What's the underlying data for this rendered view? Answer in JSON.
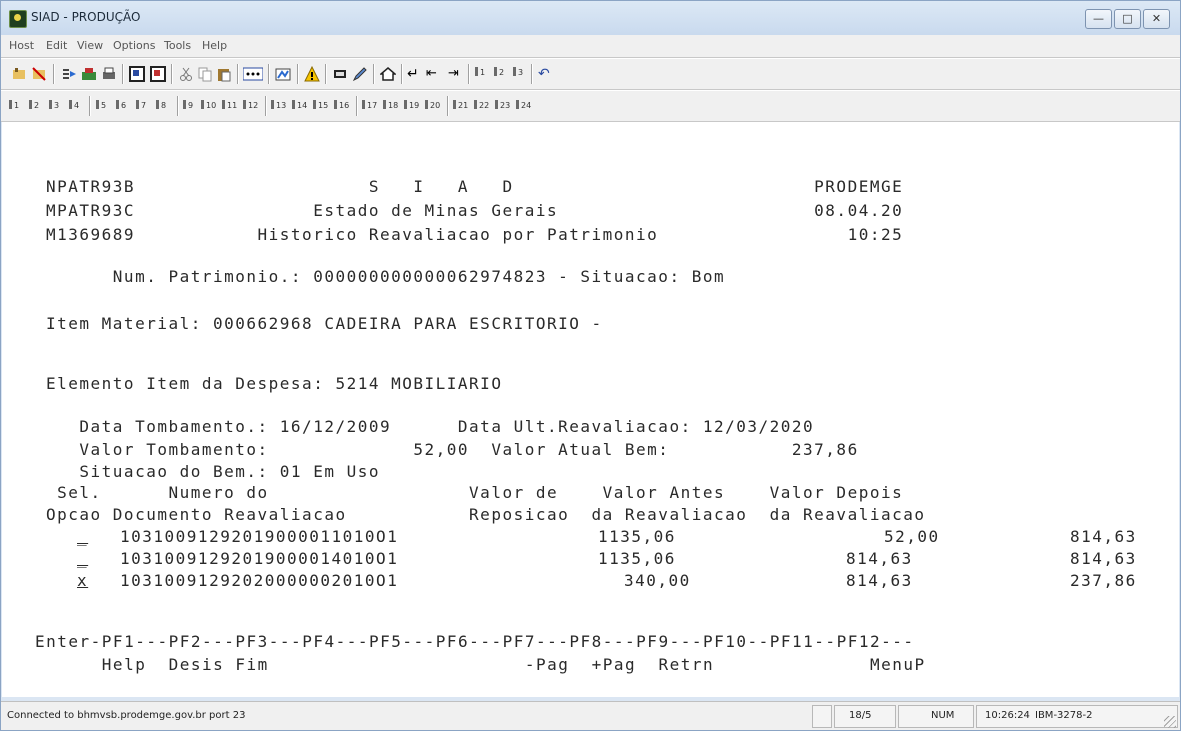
{
  "window": {
    "title": "SIAD - PRODUÇÃO",
    "buttons": [
      "minimize",
      "maximize",
      "close"
    ]
  },
  "menu": {
    "items": [
      "Host",
      "Edit",
      "View",
      "Options",
      "Tools",
      "Help"
    ]
  },
  "toolbar": {
    "icons": [
      "connect-icon",
      "disconnect-icon",
      "send-icon",
      "receive-icon",
      "print-icon",
      "screen-icon",
      "screen2-icon",
      "cut-icon",
      "copy-icon",
      "paste-icon",
      "dots-icon",
      "macro-icon",
      "warning-icon",
      "display-icon",
      "pencil-icon",
      "home-icon",
      "enter-icon",
      "backtab-icon",
      "tab-icon",
      "pf1-mini-icon",
      "pf2-mini-icon",
      "pf3-mini-icon",
      "undo-icon"
    ],
    "pf_keys": [
      "1",
      "2",
      "3",
      "4",
      "5",
      "6",
      "7",
      "8",
      "9",
      "10",
      "11",
      "12",
      "13",
      "14",
      "15",
      "16",
      "17",
      "18",
      "19",
      "20",
      "21",
      "22",
      "23",
      "24"
    ]
  },
  "terminal": {
    "lines": {
      "l1": "NPATR93B                     S   I   A   D                           PRODEMGE",
      "l2": "MPATR93C                Estado de Minas Gerais                       08.04.20",
      "l3": "M1369689           Historico Reavaliacao por Patrimonio                 10:25",
      "l4": "      Num. Patrimonio.: 000000000000062974823 - Situacao: Bom",
      "l5": "Item Material: 000662968 CADEIRA PARA ESCRITORIO -",
      "l6": "Elemento Item da Despesa: 5214 MOBILIARIO",
      "l7": "   Data Tombamento.: 16/12/2009      Data Ult.Reavaliacao: 12/03/2020",
      "l8": "   Valor Tombamento:             52,00  Valor Atual Bem:           237,86",
      "l9": "   Situacao do Bem.: 01 Em Uso",
      "l10": " Sel.      Numero do                  Valor de    Valor Antes    Valor Depois",
      "l11": "Opcao Documento Reavaliacao           Reposicao  da Reavaliacao  da Reavaliacao"
    },
    "rows": [
      {
        "sel": "_",
        "doc": "10310091292019000011010O1",
        "reposicao": "1135,06",
        "antes": "52,00",
        "depois": "814,63"
      },
      {
        "sel": "_",
        "doc": "10310091292019000014010O1",
        "reposicao": "1135,06",
        "antes": "814,63",
        "depois": "814,63"
      },
      {
        "sel": "x",
        "doc": "10310091292020000002010O1",
        "reposicao": "340,00",
        "antes": "814,63",
        "depois": "237,86"
      }
    ],
    "pf_line": "Enter-PF1---PF2---PF3---PF4---PF5---PF6---PF7---PF8---PF9---PF10--PF11--PF12---",
    "pf_labels": "      Help  Desis Fim                       -Pag  +Pag  Retrn              MenuP"
  },
  "status": {
    "connection": "Connected to bhmvsb.prodemge.gov.br port 23",
    "cursor": "18/5",
    "numlock": "NUM",
    "time": "10:26:24",
    "terminal_type": "IBM-3278-2"
  }
}
